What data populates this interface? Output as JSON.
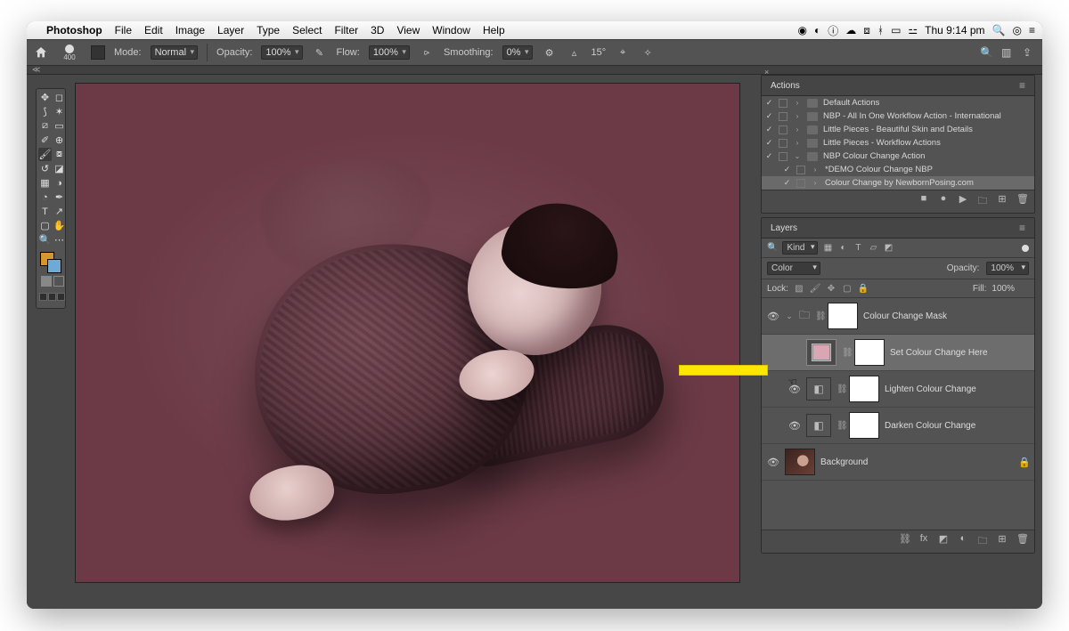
{
  "menubar": {
    "app": "Photoshop",
    "items": [
      "File",
      "Edit",
      "Image",
      "Layer",
      "Type",
      "Select",
      "Filter",
      "3D",
      "View",
      "Window",
      "Help"
    ],
    "clock": "Thu 9:14 pm"
  },
  "options": {
    "brush_size": "400",
    "mode_label": "Mode:",
    "mode_value": "Normal",
    "opacity_label": "Opacity:",
    "opacity_value": "100%",
    "flow_label": "Flow:",
    "flow_value": "100%",
    "smoothing_label": "Smoothing:",
    "smoothing_value": "0%",
    "angle_icon": "▵",
    "angle_value": "15°"
  },
  "panels": {
    "actions": {
      "title": "Actions",
      "items": [
        {
          "checked": true,
          "expand": ">",
          "folder": true,
          "label": "Default Actions"
        },
        {
          "checked": true,
          "expand": ">",
          "folder": true,
          "label": "NBP - All In One Workflow Action - International"
        },
        {
          "checked": true,
          "expand": ">",
          "folder": true,
          "label": "Little Pieces - Beautiful Skin and Details"
        },
        {
          "checked": true,
          "expand": ">",
          "folder": true,
          "label": "Little Pieces - Workflow Actions"
        },
        {
          "checked": true,
          "expand": "⌄",
          "folder": true,
          "label": "NBP Colour Change Action"
        },
        {
          "checked": true,
          "expand": ">",
          "folder": false,
          "label": "*DEMO Colour Change NBP"
        },
        {
          "checked": true,
          "expand": ">",
          "folder": false,
          "label": "Colour Change by NewbornPosing.com",
          "sel": true
        }
      ]
    },
    "layers": {
      "title": "Layers",
      "kind_label": "Kind",
      "blend_mode": "Color",
      "opacity_label": "Opacity:",
      "opacity_value": "100%",
      "lock_label": "Lock:",
      "fill_label": "Fill:",
      "fill_value": "100%",
      "rows": [
        {
          "type": "group",
          "visible": true,
          "name": "Colour Change Mask"
        },
        {
          "type": "colorfill",
          "visible": false,
          "name": "Set Colour Change Here",
          "sel": true,
          "swatch": "#d9a7b3"
        },
        {
          "type": "adjust",
          "visible": true,
          "name": "Lighten Colour Change"
        },
        {
          "type": "adjust",
          "visible": true,
          "name": "Darken Colour Change"
        },
        {
          "type": "bg",
          "visible": true,
          "name": "Background",
          "locked": true
        }
      ]
    }
  },
  "search_icon": "search"
}
